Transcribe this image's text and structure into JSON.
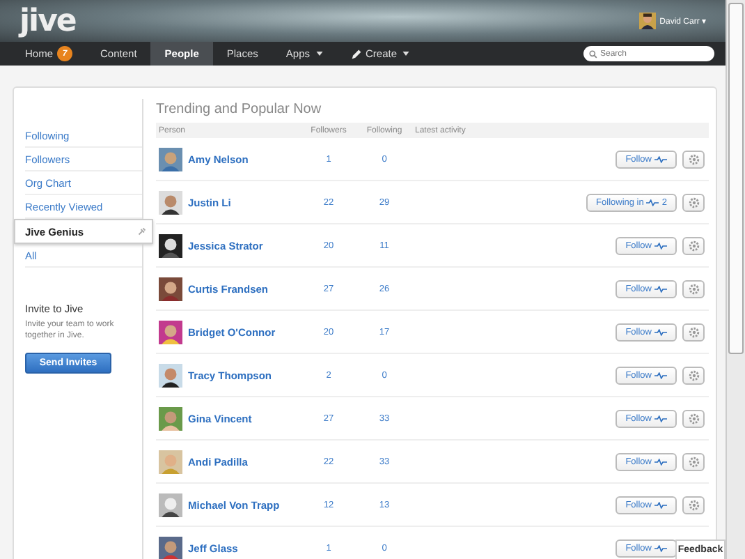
{
  "header": {
    "logo": "jive",
    "user": {
      "name": "David Carr",
      "caret": "▾"
    }
  },
  "nav": [
    {
      "label": "Home",
      "kind": "link",
      "badge": "7",
      "selected": false
    },
    {
      "label": "Content",
      "kind": "link",
      "selected": false
    },
    {
      "label": "People",
      "kind": "link",
      "selected": true
    },
    {
      "label": "Places",
      "kind": "link",
      "selected": false
    },
    {
      "label": "Apps",
      "kind": "menu",
      "selected": false
    },
    {
      "label": "Create",
      "kind": "create-menu",
      "selected": false
    }
  ],
  "search": {
    "placeholder": "Search"
  },
  "sidebar": {
    "items": [
      {
        "label": "Following",
        "selected": false
      },
      {
        "label": "Followers",
        "selected": false
      },
      {
        "label": "Org Chart",
        "selected": false
      },
      {
        "label": "Recently Viewed",
        "selected": false
      },
      {
        "label": "Jive Genius",
        "selected": true
      },
      {
        "label": "All",
        "selected": false
      }
    ],
    "invite": {
      "title": "Invite to Jive",
      "text": "Invite your team to work together in Jive.",
      "button": "Send Invites"
    }
  },
  "table": {
    "title": "Trending and Popular Now",
    "columns": [
      "Person",
      "Followers",
      "Following",
      "Latest activity"
    ],
    "rows": [
      {
        "name": "Amy Nelson",
        "followers": "1",
        "following": "0",
        "button": {
          "label": "Follow"
        }
      },
      {
        "name": "Justin Li",
        "followers": "22",
        "following": "29",
        "button": {
          "label": "Following in",
          "count": "2"
        }
      },
      {
        "name": "Jessica Strator",
        "followers": "20",
        "following": "11",
        "button": {
          "label": "Follow"
        }
      },
      {
        "name": "Curtis Frandsen",
        "followers": "27",
        "following": "26",
        "button": {
          "label": "Follow"
        }
      },
      {
        "name": "Bridget O'Connor",
        "followers": "20",
        "following": "17",
        "button": {
          "label": "Follow"
        }
      },
      {
        "name": "Tracy Thompson",
        "followers": "2",
        "following": "0",
        "button": {
          "label": "Follow"
        }
      },
      {
        "name": "Gina Vincent",
        "followers": "27",
        "following": "33",
        "button": {
          "label": "Follow"
        }
      },
      {
        "name": "Andi Padilla",
        "followers": "22",
        "following": "33",
        "button": {
          "label": "Follow"
        }
      },
      {
        "name": "Michael Von Trapp",
        "followers": "12",
        "following": "13",
        "button": {
          "label": "Follow"
        }
      },
      {
        "name": "Jeff Glass",
        "followers": "1",
        "following": "0",
        "button": {
          "label": "Follow"
        }
      }
    ]
  },
  "feedback": "Feedback"
}
